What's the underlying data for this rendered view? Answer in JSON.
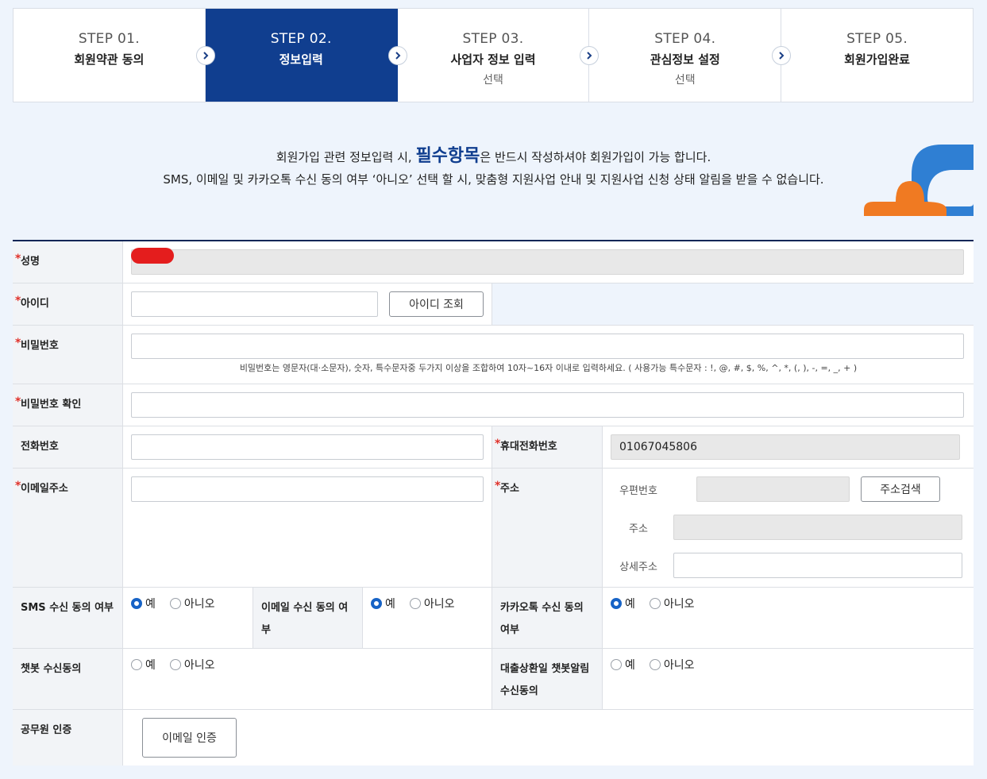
{
  "steps": [
    {
      "num": "STEP 01.",
      "title": "회원약관 동의",
      "sub": ""
    },
    {
      "num": "STEP 02.",
      "title": "정보입력",
      "sub": ""
    },
    {
      "num": "STEP 03.",
      "title": "사업자 정보 입력",
      "sub": "선택"
    },
    {
      "num": "STEP 04.",
      "title": "관심정보 설정",
      "sub": "선택"
    },
    {
      "num": "STEP 05.",
      "title": "회원가입완료",
      "sub": ""
    }
  ],
  "notice": {
    "line1_pre": "회원가입 관련 정보입력 시, ",
    "line1_big": "필수항목",
    "line1_post": "은 반드시 작성하셔야 회원가입이 가능 합니다.",
    "line2": "SMS, 이메일 및 카카오톡 수신 동의 여부 ‘아니오’ 선택 할 시, 맞춤형 지원사업 안내 및 지원사업 신청 상태 알림을 받을 수 없습니다."
  },
  "form": {
    "name_label": "성명",
    "id_label": "아이디",
    "id_check_button": "아이디 조회",
    "password_label": "비밀번호",
    "password_hint": "비밀번호는 영문자(대·소문자), 숫자, 특수문자중 두가지 이상을 조합하여 10자~16자 이내로 입력하세요. ( 사용가능 특수문자 : !, @, #, $, %, ^, *, (, ), -, =, _, + )",
    "password_confirm_label": "비밀번호 확인",
    "phone_label": "전화번호",
    "mobile_label": "휴대전화번호",
    "mobile_value": "01067045806",
    "email_label": "이메일주소",
    "address_label": "주소",
    "zipcode_label": "우편번호",
    "address_search_button": "주소검색",
    "address_sub_label": "주소",
    "address_detail_label": "상세주소",
    "sms_label": "SMS 수신 동의 여부",
    "email_consent_label": "이메일 수신 동의 여부",
    "kakao_label": "카카오톡 수신 동의 여부",
    "chatbot_label": "챗봇 수신동의",
    "loan_chatbot_label": "대출상환일 챗봇알림 수신동의",
    "official_label": "공무원 인증",
    "email_verify_button": "이메일 인증",
    "yes": "예",
    "no": "아니오"
  },
  "colors": {
    "accent": "#103e8f",
    "required": "#e0312a",
    "radio_on": "#1763c6"
  }
}
